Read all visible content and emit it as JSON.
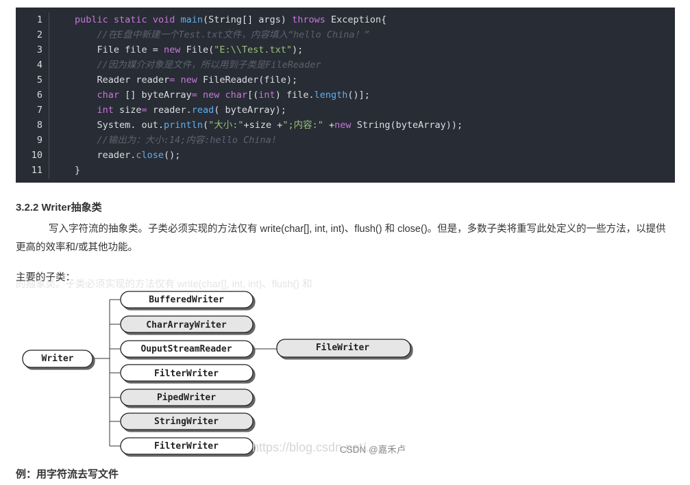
{
  "code": {
    "line_numbers": [
      "1",
      "2",
      "3",
      "4",
      "5",
      "6",
      "7",
      "8",
      "9",
      "10",
      "11"
    ],
    "lines": [
      [
        {
          "t": "public",
          "c": "kw"
        },
        {
          "t": " "
        },
        {
          "t": "static",
          "c": "kw"
        },
        {
          "t": " "
        },
        {
          "t": "void",
          "c": "kw"
        },
        {
          "t": " "
        },
        {
          "t": "main",
          "c": "fn"
        },
        {
          "t": "(String[] args) "
        },
        {
          "t": "throws",
          "c": "kw"
        },
        {
          "t": " Exception{"
        }
      ],
      [
        {
          "t": "    "
        },
        {
          "t": "//在E盘中新建一个Test.txt文件，内容填入“hello China！”",
          "c": "cm"
        }
      ],
      [
        {
          "t": "    File file = "
        },
        {
          "t": "new",
          "c": "kw"
        },
        {
          "t": " File("
        },
        {
          "t": "\"E:\\\\Test.txt\"",
          "c": "str"
        },
        {
          "t": ");"
        }
      ],
      [
        {
          "t": "    "
        },
        {
          "t": "//因为媒介对象是文件，所以用到子类是FileReader",
          "c": "cm"
        }
      ],
      [
        {
          "t": "    Reader reader"
        },
        {
          "t": "=",
          "c": "kw"
        },
        {
          "t": " "
        },
        {
          "t": "new",
          "c": "kw"
        },
        {
          "t": " FileReader(file);"
        }
      ],
      [
        {
          "t": "    "
        },
        {
          "t": "char",
          "c": "kw"
        },
        {
          "t": " [] byteArray"
        },
        {
          "t": "=",
          "c": "kw"
        },
        {
          "t": " "
        },
        {
          "t": "new",
          "c": "kw"
        },
        {
          "t": " "
        },
        {
          "t": "char",
          "c": "kw"
        },
        {
          "t": "[("
        },
        {
          "t": "int",
          "c": "kw"
        },
        {
          "t": ") file."
        },
        {
          "t": "length",
          "c": "fn"
        },
        {
          "t": "()];"
        }
      ],
      [
        {
          "t": "    "
        },
        {
          "t": "int",
          "c": "kw"
        },
        {
          "t": " size"
        },
        {
          "t": "=",
          "c": "kw"
        },
        {
          "t": " reader."
        },
        {
          "t": "read",
          "c": "fn"
        },
        {
          "t": "( byteArray);"
        }
      ],
      [
        {
          "t": "    System. out."
        },
        {
          "t": "println",
          "c": "fn"
        },
        {
          "t": "("
        },
        {
          "t": "\"大小:\"",
          "c": "str"
        },
        {
          "t": "+size +"
        },
        {
          "t": "\";内容:\"",
          "c": "str"
        },
        {
          "t": " +"
        },
        {
          "t": "new",
          "c": "kw"
        },
        {
          "t": " String(byteArray));"
        }
      ],
      [
        {
          "t": "    "
        },
        {
          "t": "//输出为：大小:14;内容:hello China!",
          "c": "cm"
        }
      ],
      [
        {
          "t": "    reader."
        },
        {
          "t": "close",
          "c": "fn"
        },
        {
          "t": "();"
        }
      ],
      [
        {
          "t": "}"
        }
      ]
    ]
  },
  "heading": "3.2.2 Writer抽象类",
  "paragraph": "写入字符流的抽象类。子类必须实现的方法仅有 write(char[], int, int)、flush() 和 close()。但是，多数子类将重写此处定义的一些方法，以提供更高的效率和/或其他功能。",
  "subclasses_label": "主要的子类：",
  "ghost_text": "的抽象类。子类必须实现的方法仅有 write(char[], int, int)、flush() 和",
  "diagram": {
    "root": "Writer",
    "children": [
      "BufferedWriter",
      "CharArrayWriter",
      "OuputStreamReader",
      "FilterWriter",
      "PipedWriter",
      "StringWriter",
      "FilterWriter"
    ],
    "grandchild": "FileWriter"
  },
  "watermark_url": "https://blog.csdn.net/...",
  "watermark": "CSDN @嘉禾卢",
  "example_heading": "例：用字符流去写文件",
  "colors": {
    "code_bg": "#282c34",
    "keyword": "#c678dd",
    "function": "#61afef",
    "string": "#98c379",
    "comment": "#5c6370",
    "node_fill": "#ffffff",
    "node_fill_alt": "#e6e6e6"
  }
}
